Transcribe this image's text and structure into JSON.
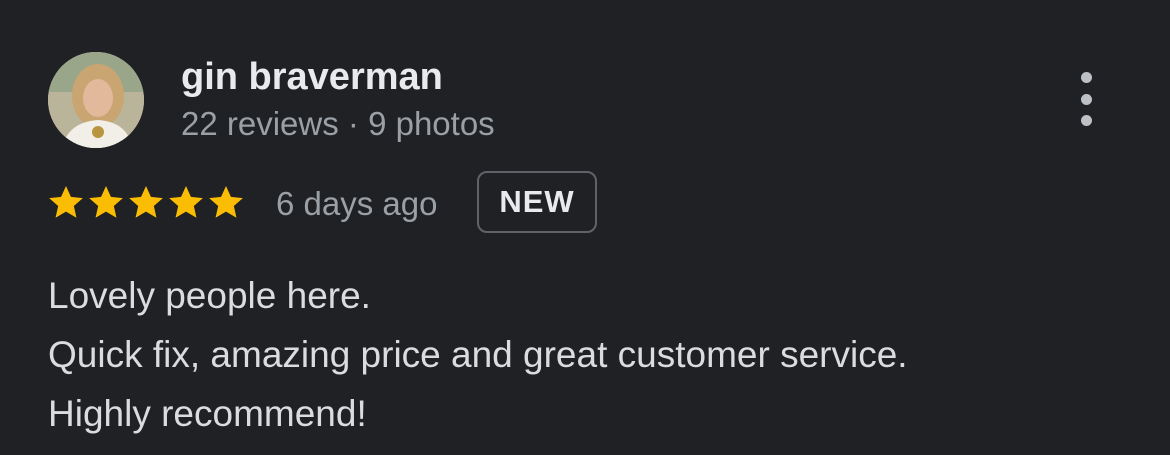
{
  "reviewer": {
    "name": "gin braverman",
    "reviews_count": "22 reviews",
    "separator": "·",
    "photos_count": "9 photos"
  },
  "rating": {
    "value": 5,
    "max": 5,
    "star_color": "#fbbc04"
  },
  "review": {
    "date": "6 days ago",
    "badge": "NEW",
    "lines": [
      "Lovely people here.",
      "Quick fix, amazing price and great customer service.",
      "Highly recommend!"
    ]
  },
  "icons": {
    "more": "more-vert-icon",
    "star": "star-icon"
  }
}
